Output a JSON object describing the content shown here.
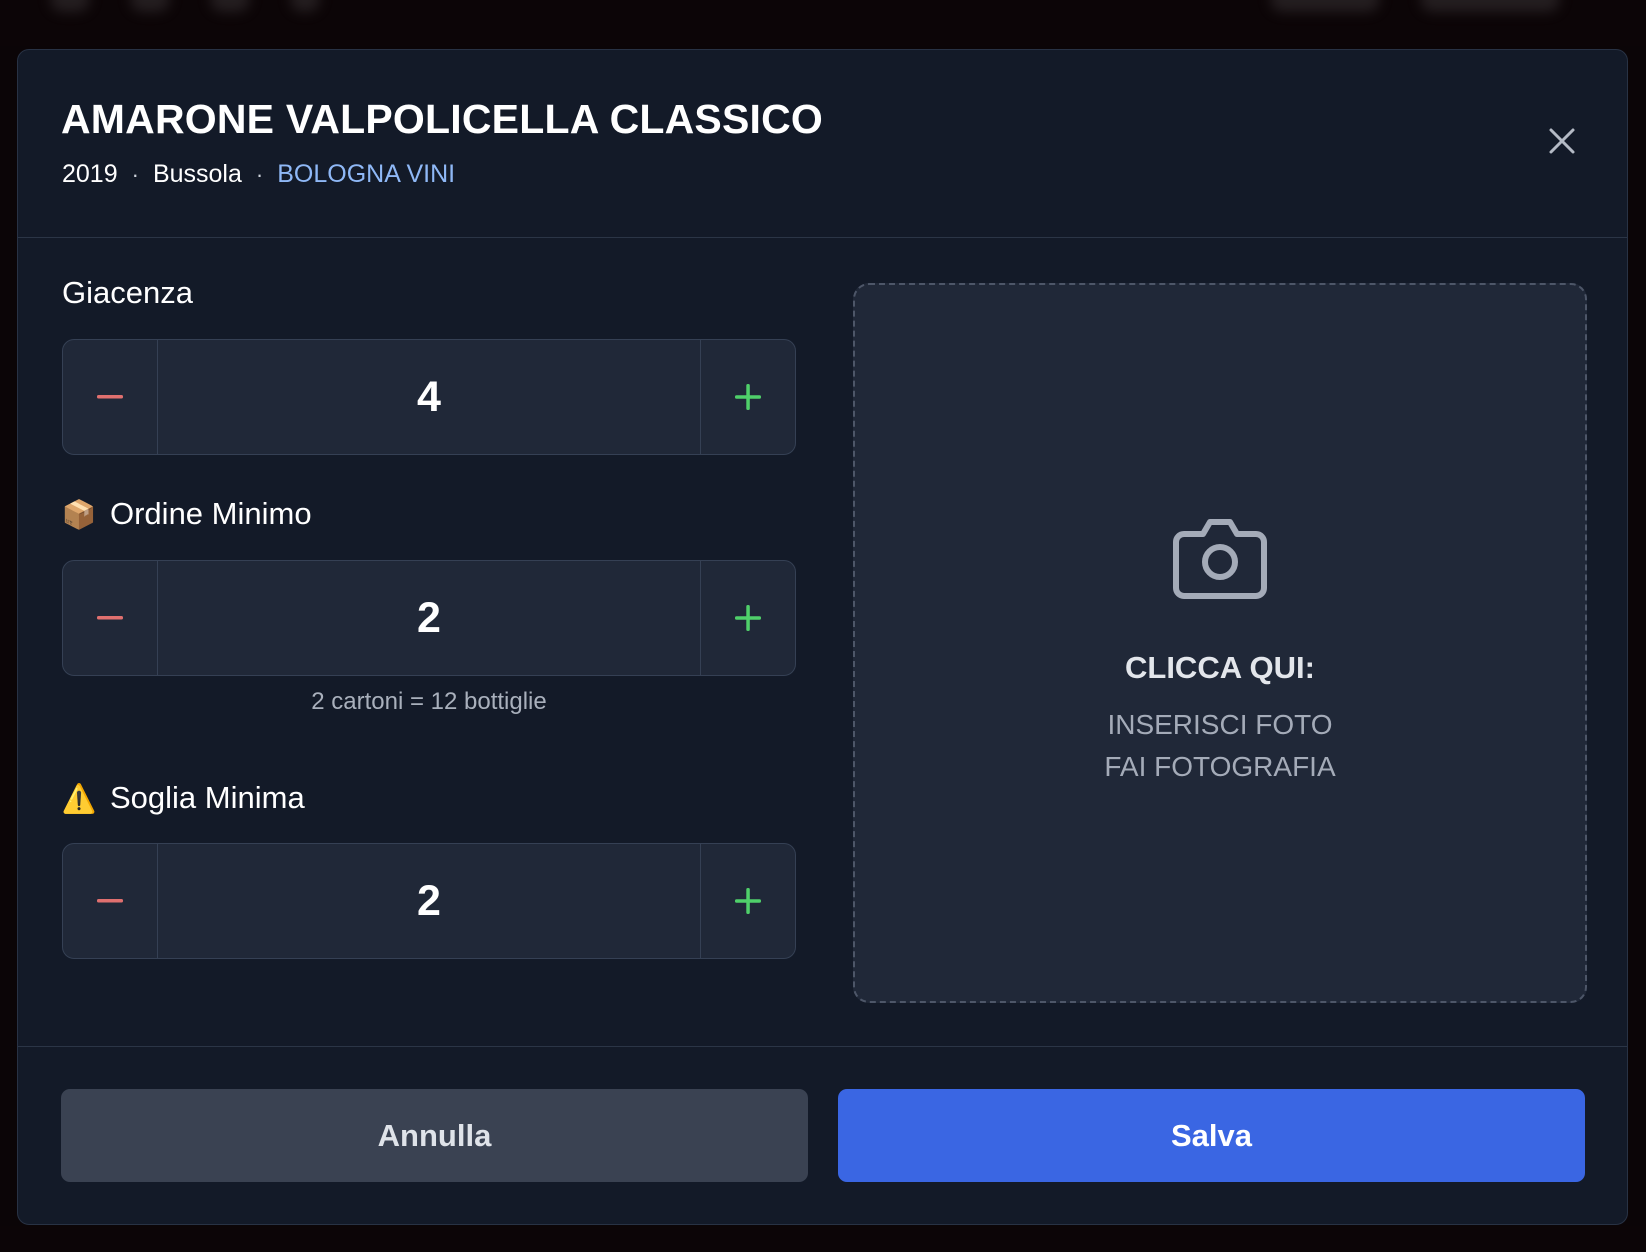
{
  "wine": {
    "title": "AMARONE VALPOLICELLA CLASSICO",
    "vintage": "2019",
    "producer": "Bussola",
    "distributor": "BOLOGNA VINI",
    "separator": "·"
  },
  "fields": {
    "stock": {
      "label": "Giacenza",
      "value": "4"
    },
    "min_order": {
      "label": "Ordine Minimo",
      "emoji": "📦",
      "value": "2",
      "hint": "2 cartoni = 12 bottiglie"
    },
    "min_threshold": {
      "label": "Soglia Minima",
      "emoji": "⚠️",
      "value": "2"
    }
  },
  "stepper": {
    "minus_symbol": "−",
    "plus_symbol": "+"
  },
  "photo": {
    "title": "CLICCA QUI:",
    "line1": "INSERISCI FOTO",
    "line2": "FAI FOTOGRAFIA"
  },
  "footer": {
    "cancel_label": "Annulla",
    "save_label": "Salva"
  },
  "colors": {
    "modal_bg": "#131a28",
    "minus": "#e0706f",
    "plus": "#4fd06a",
    "accent": "#3a66e3",
    "distributor": "#8fb8f6"
  },
  "icons": {
    "close": "close-icon",
    "camera": "camera-icon",
    "minus": "minus-icon",
    "plus": "plus-icon"
  }
}
